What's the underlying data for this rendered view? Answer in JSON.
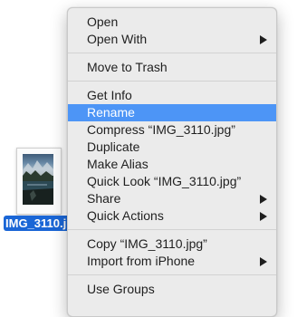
{
  "file": {
    "name": "IMG_3110.jpg"
  },
  "menu": {
    "groups": [
      [
        "Open",
        "Open With"
      ],
      [
        "Move to Trash"
      ],
      [
        "Get Info",
        "Rename",
        "Compress “IMG_3110.jpg”",
        "Duplicate",
        "Make Alias",
        "Quick Look “IMG_3110.jpg”",
        "Share",
        "Quick Actions"
      ],
      [
        "Copy “IMG_3110.jpg”",
        "Import from iPhone"
      ],
      [
        "Use Groups"
      ]
    ],
    "selected_item": "Rename",
    "submenu_items": [
      "Open With",
      "Share",
      "Quick Actions",
      "Import from iPhone"
    ],
    "submenu_arrow_icon": "triangle-right-icon"
  },
  "colors": {
    "selection": "#4d95f6",
    "file_label_selection": "#1a66d6"
  }
}
